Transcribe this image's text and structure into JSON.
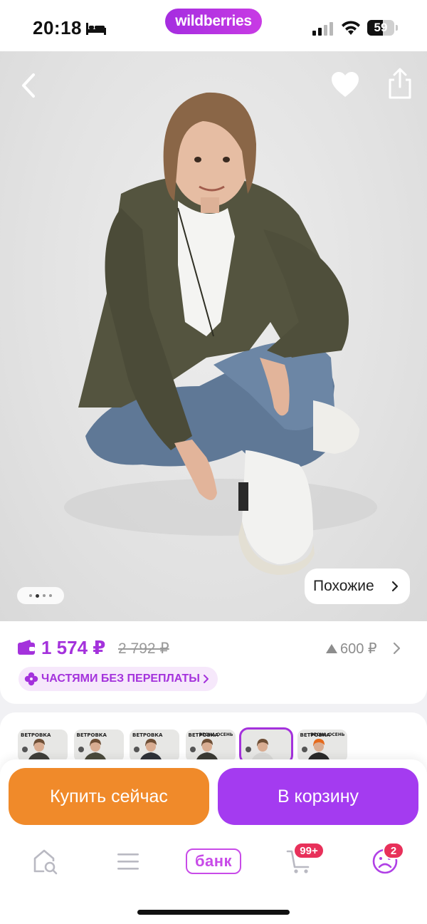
{
  "status_bar": {
    "time": "20:18",
    "brand": "wildberries",
    "battery_level": "59",
    "battery_fraction": 0.59
  },
  "hero": {
    "image_count": 4,
    "active_image_index": 1,
    "similar_label": "Похожие"
  },
  "price": {
    "current": "1 574 ₽",
    "old": "2 792 ₽",
    "drop": "600 ₽",
    "installment": "ЧАСТЯМИ БЕЗ ПЕРЕПЛАТЫ"
  },
  "color_variants": [
    {
      "label": "ВЕТРОВКА",
      "tag": ""
    },
    {
      "label": "ВЕТРОВКА",
      "tag": ""
    },
    {
      "label": "ВЕТРОВКА",
      "tag": ""
    },
    {
      "label": "ВЕТРОВКА",
      "tag": "ВЕСНА ОСЕНЬ"
    },
    {
      "label": "",
      "tag": ""
    },
    {
      "label": "ВЕТРОВКА",
      "tag": "ВЕСНА-ОСЕНЬ"
    }
  ],
  "selected_variant_index": 4,
  "actions": {
    "buy_now": "Купить сейчас",
    "add_to_cart": "В корзину"
  },
  "tabbar": {
    "bank_label": "банк",
    "cart_badge": "99+",
    "profile_badge": "2"
  },
  "colors": {
    "accent": "#a432dc",
    "buy_now": "#f08a2a",
    "cart": "#a43bf0",
    "badge": "#e8305a"
  },
  "icons": [
    "bed-icon",
    "signal-icon",
    "wifi-icon",
    "back-icon",
    "heart-icon",
    "share-icon",
    "wallet-icon",
    "clover-icon",
    "search-home-icon",
    "menu-icon",
    "cart-icon",
    "profile-icon"
  ]
}
